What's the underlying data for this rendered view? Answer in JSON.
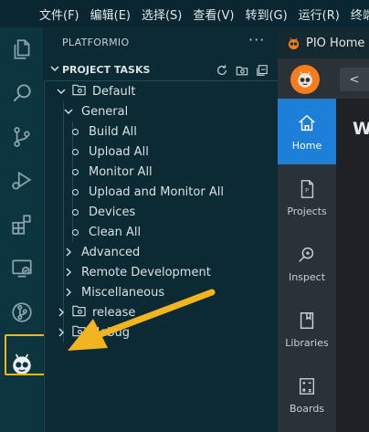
{
  "menu": [
    "文件(F)",
    "编辑(E)",
    "选择(S)",
    "查看(V)",
    "转到(G)",
    "运行(R)",
    "终端"
  ],
  "activity": [
    {
      "name": "explorer-icon"
    },
    {
      "name": "search-icon"
    },
    {
      "name": "source-control-icon"
    },
    {
      "name": "run-debug-icon"
    },
    {
      "name": "extensions-icon"
    },
    {
      "name": "remote-explorer-icon"
    },
    {
      "name": "git-graph-icon"
    },
    {
      "name": "platformio-icon"
    }
  ],
  "sidebar": {
    "title": "PLATFORMIO",
    "more": "···",
    "section": "PROJECT TASKS",
    "tree": {
      "default_env": "Default",
      "general": "General",
      "tasks": [
        "Build All",
        "Upload All",
        "Monitor All",
        "Upload and Monitor All",
        "Devices",
        "Clean All"
      ],
      "groups": [
        "Advanced",
        "Remote Development",
        "Miscellaneous"
      ],
      "release_env": "release",
      "debug_env": "debug"
    }
  },
  "editor": {
    "tab": "PIO Home",
    "back": "<",
    "nav": [
      {
        "label": "Home",
        "active": true
      },
      {
        "label": "Projects",
        "active": false
      },
      {
        "label": "Inspect",
        "active": false
      },
      {
        "label": "Libraries",
        "active": false
      },
      {
        "label": "Boards",
        "active": false
      }
    ],
    "heading": "W"
  },
  "colors": {
    "highlight": "#f2b51d",
    "pio_orange": "#f57c1f",
    "nav_active": "#1d7fd8"
  }
}
